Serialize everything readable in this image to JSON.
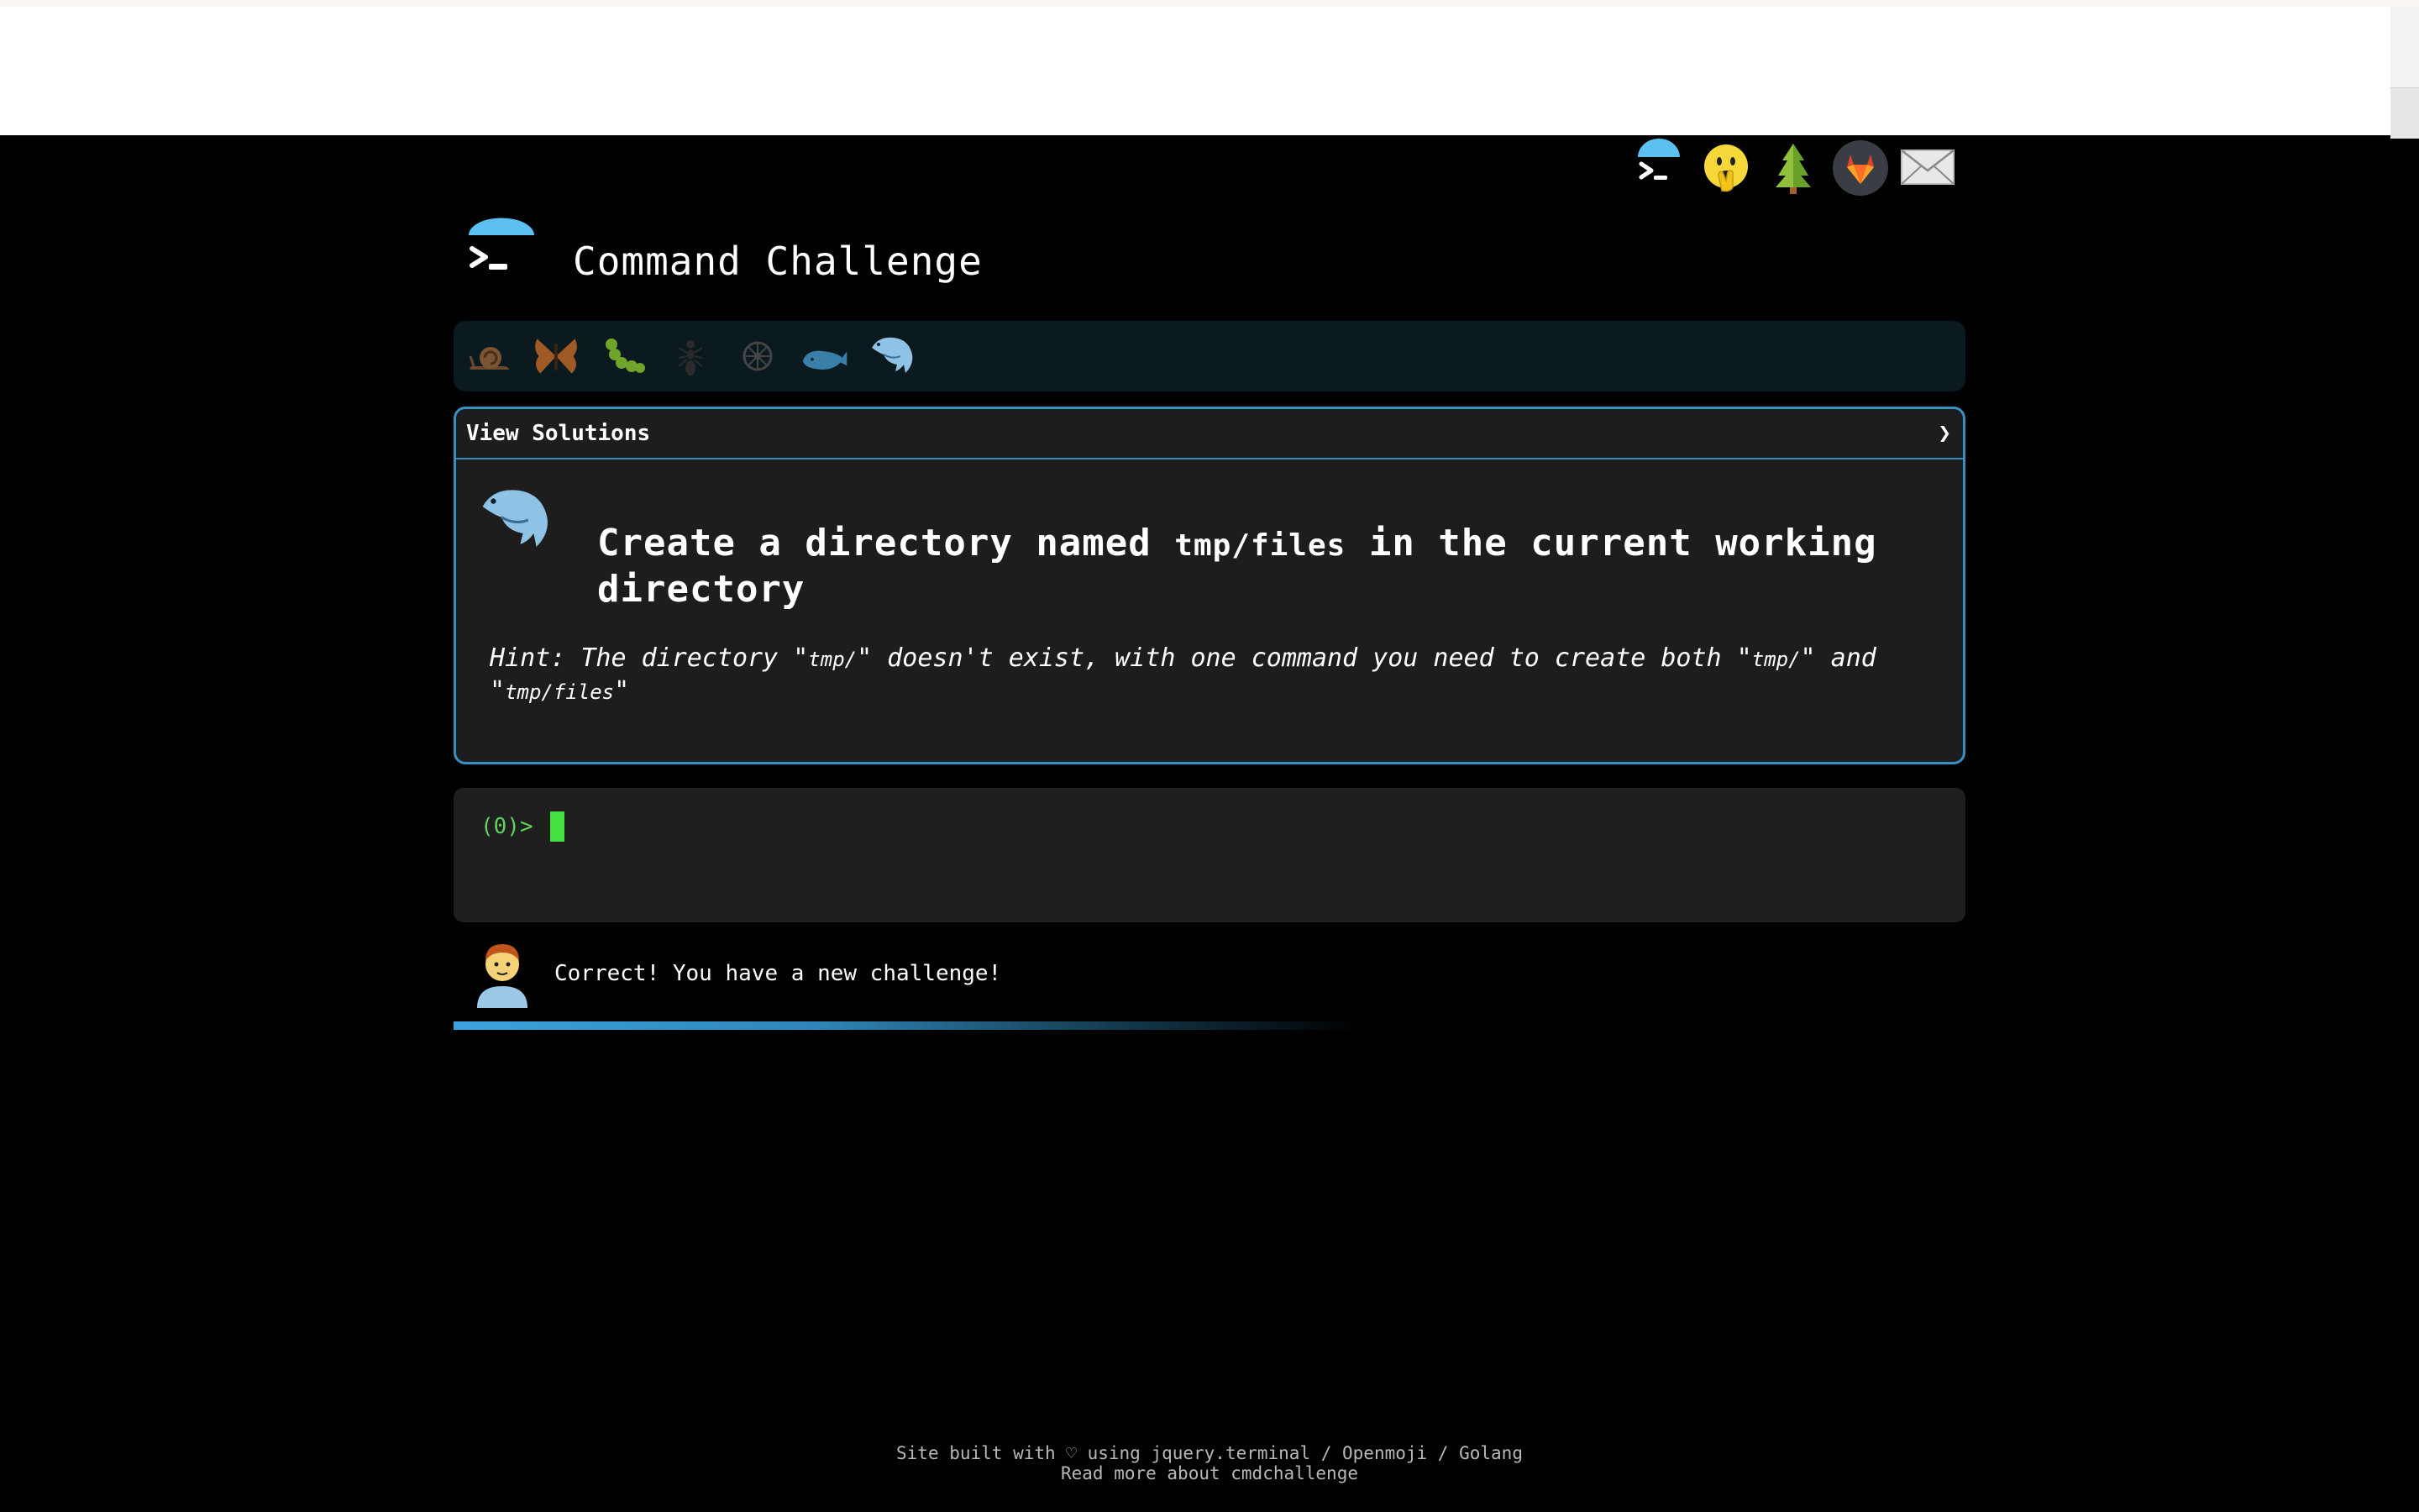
{
  "header": {
    "title": "Command Challenge",
    "icons": [
      "terminal-icon",
      "hand-over-mouth-icon",
      "tree-icon",
      "gitlab-icon",
      "envelope-icon"
    ]
  },
  "levels": [
    "snail-icon",
    "butterfly-icon",
    "caterpillar-icon",
    "ant-icon",
    "wheel-icon",
    "whale-icon",
    "dolphin-icon"
  ],
  "panel": {
    "view_solutions": "View Solutions",
    "chevron": "❯",
    "challenge_prefix": "Create a directory named ",
    "challenge_code": "tmp/files",
    "challenge_suffix": " in the current working directory",
    "hint_prefix": "Hint: The directory \"",
    "hint_code1": "tmp/",
    "hint_mid": "\" doesn't exist, with one command you need to create both \"",
    "hint_code2": "tmp/",
    "hint_and": "\" and \"",
    "hint_code3": "tmp/files",
    "hint_end": "\""
  },
  "terminal": {
    "prompt": "(0)>"
  },
  "status": {
    "message": "Correct! You have a new challenge!",
    "progress": 0.6
  },
  "footer": {
    "line1": "Site built with ♡ using jquery.terminal / Openmoji / Golang",
    "line2": "Read more about cmdchallenge"
  },
  "colors": {
    "accent": "#3b8fbf",
    "prompt_green": "#5fd35f",
    "cursor_green": "#44e03f"
  }
}
